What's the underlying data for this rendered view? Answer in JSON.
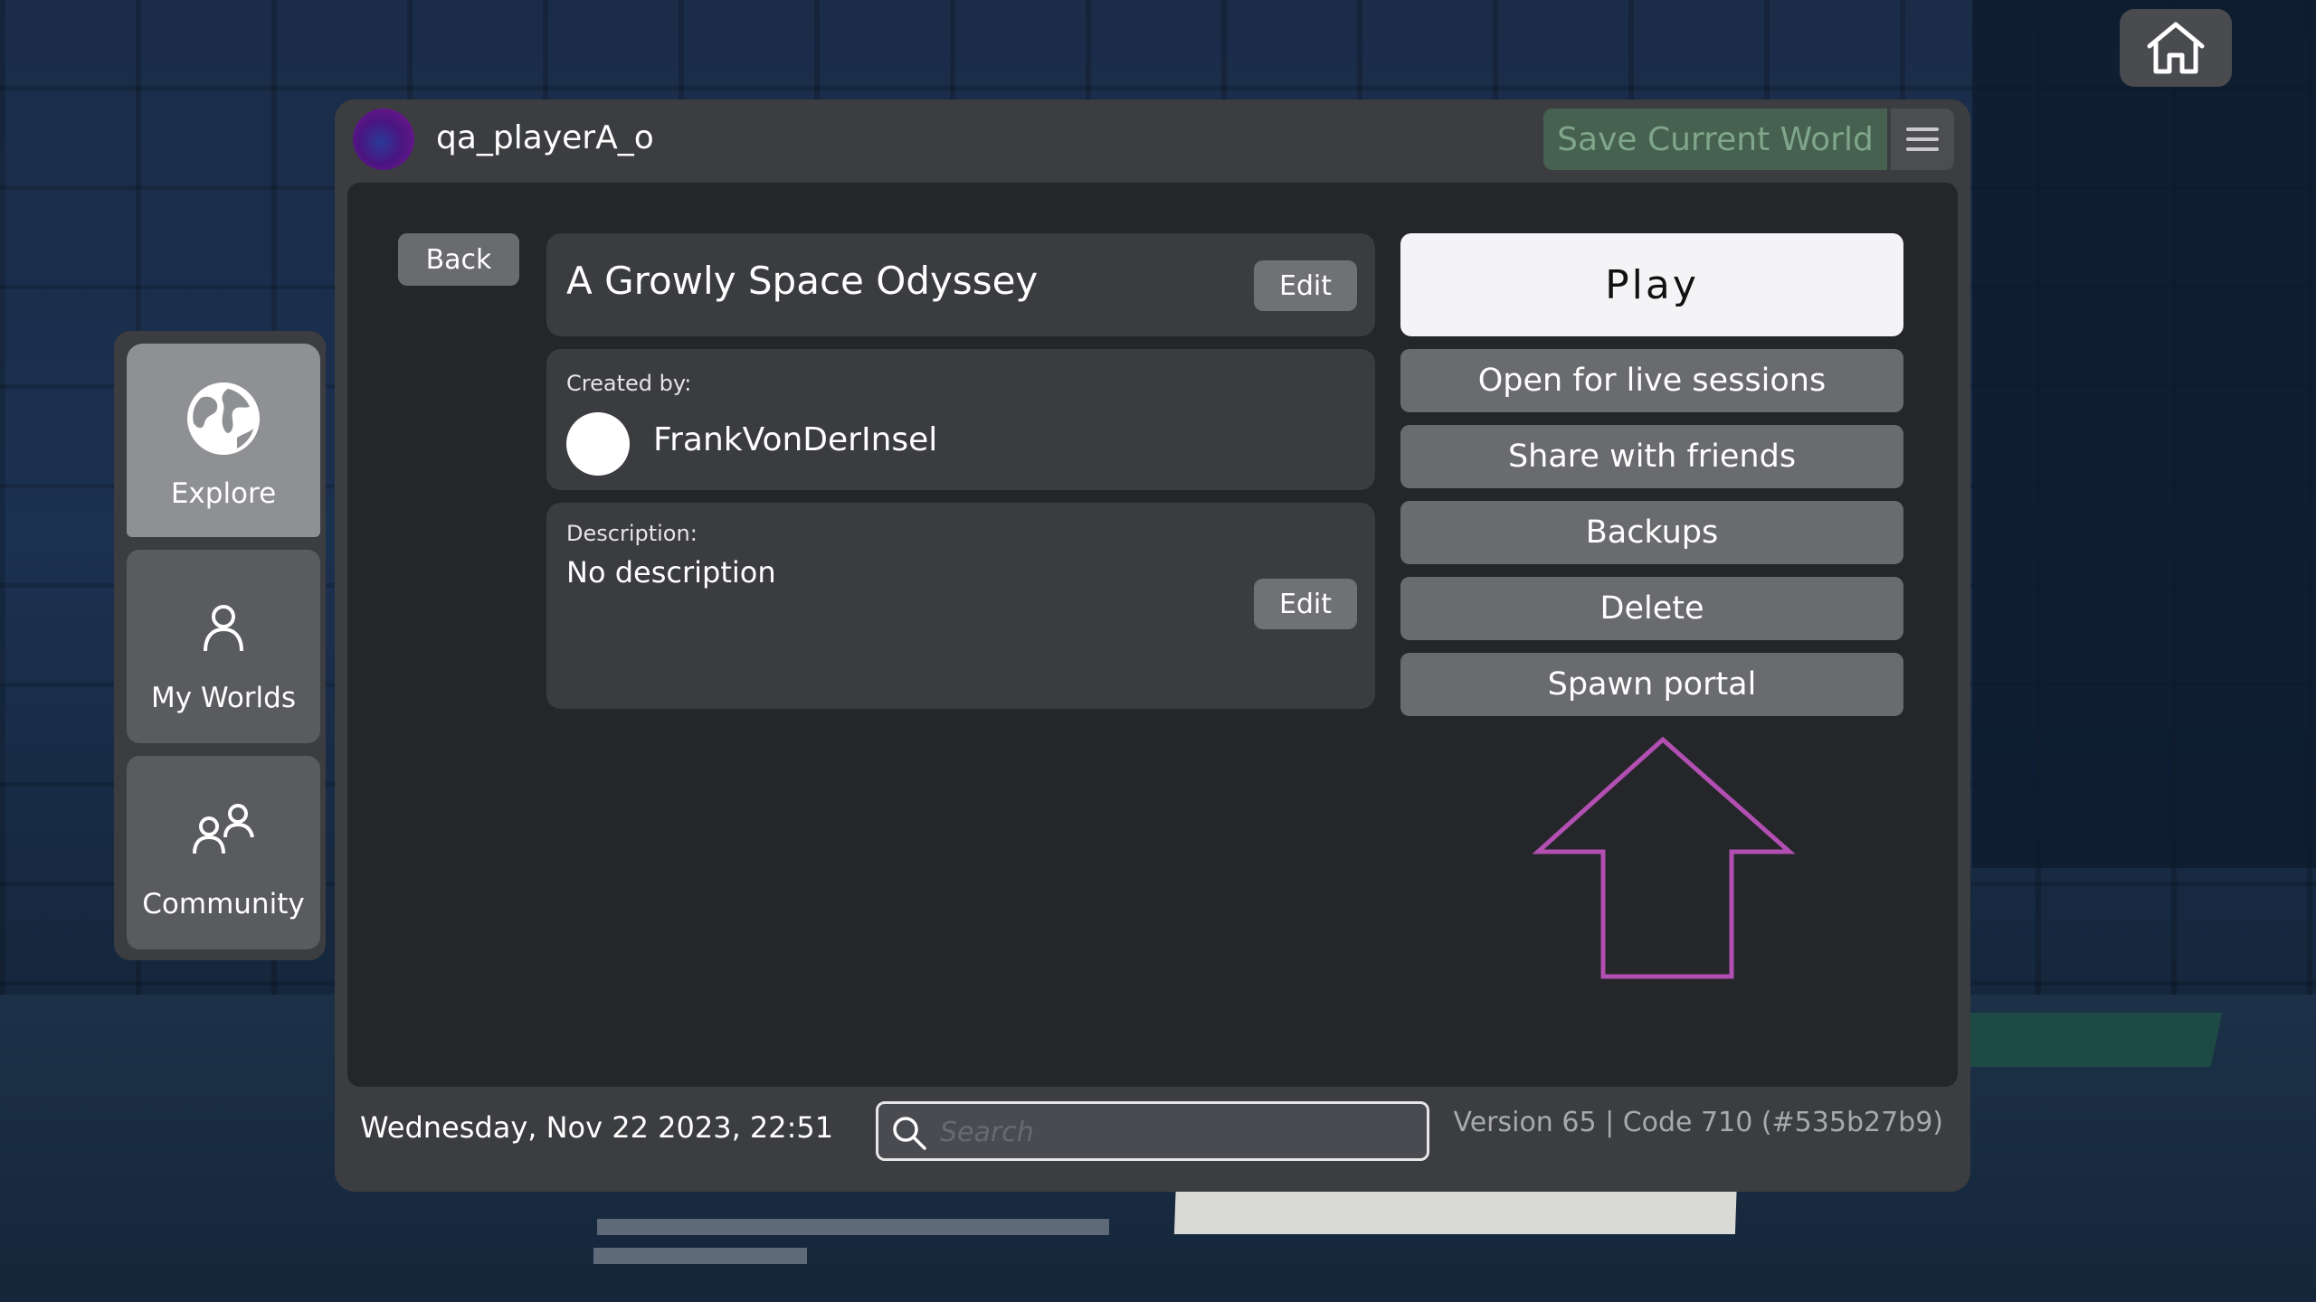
{
  "header": {
    "username": "qa_playerA_o",
    "save_label": "Save Current World"
  },
  "sidebar": {
    "items": [
      {
        "label": "Explore",
        "icon": "globe-icon",
        "active": true
      },
      {
        "label": "My Worlds",
        "icon": "person-icon",
        "active": false
      },
      {
        "label": "Community",
        "icon": "people-icon",
        "active": false
      }
    ]
  },
  "main": {
    "back_label": "Back",
    "world_title": "A Growly Space Odyssey",
    "edit_label": "Edit",
    "created_by_label": "Created by:",
    "creator_name": "FrankVonDerInsel",
    "description_label": "Description:",
    "description_text": "No description"
  },
  "actions": {
    "play": "Play",
    "open_live": "Open for live sessions",
    "share": "Share with friends",
    "backups": "Backups",
    "delete": "Delete",
    "spawn_portal": "Spawn portal"
  },
  "footer": {
    "datetime": "Wednesday, Nov 22 2023, 22:51",
    "search_placeholder": "Search",
    "version": "Version 65 | Code 710 (#535b27b9)"
  },
  "colors": {
    "accent_arrow": "#b24fb2",
    "save_button_bg": "#46614f",
    "play_button_bg": "#f4f4f6"
  }
}
